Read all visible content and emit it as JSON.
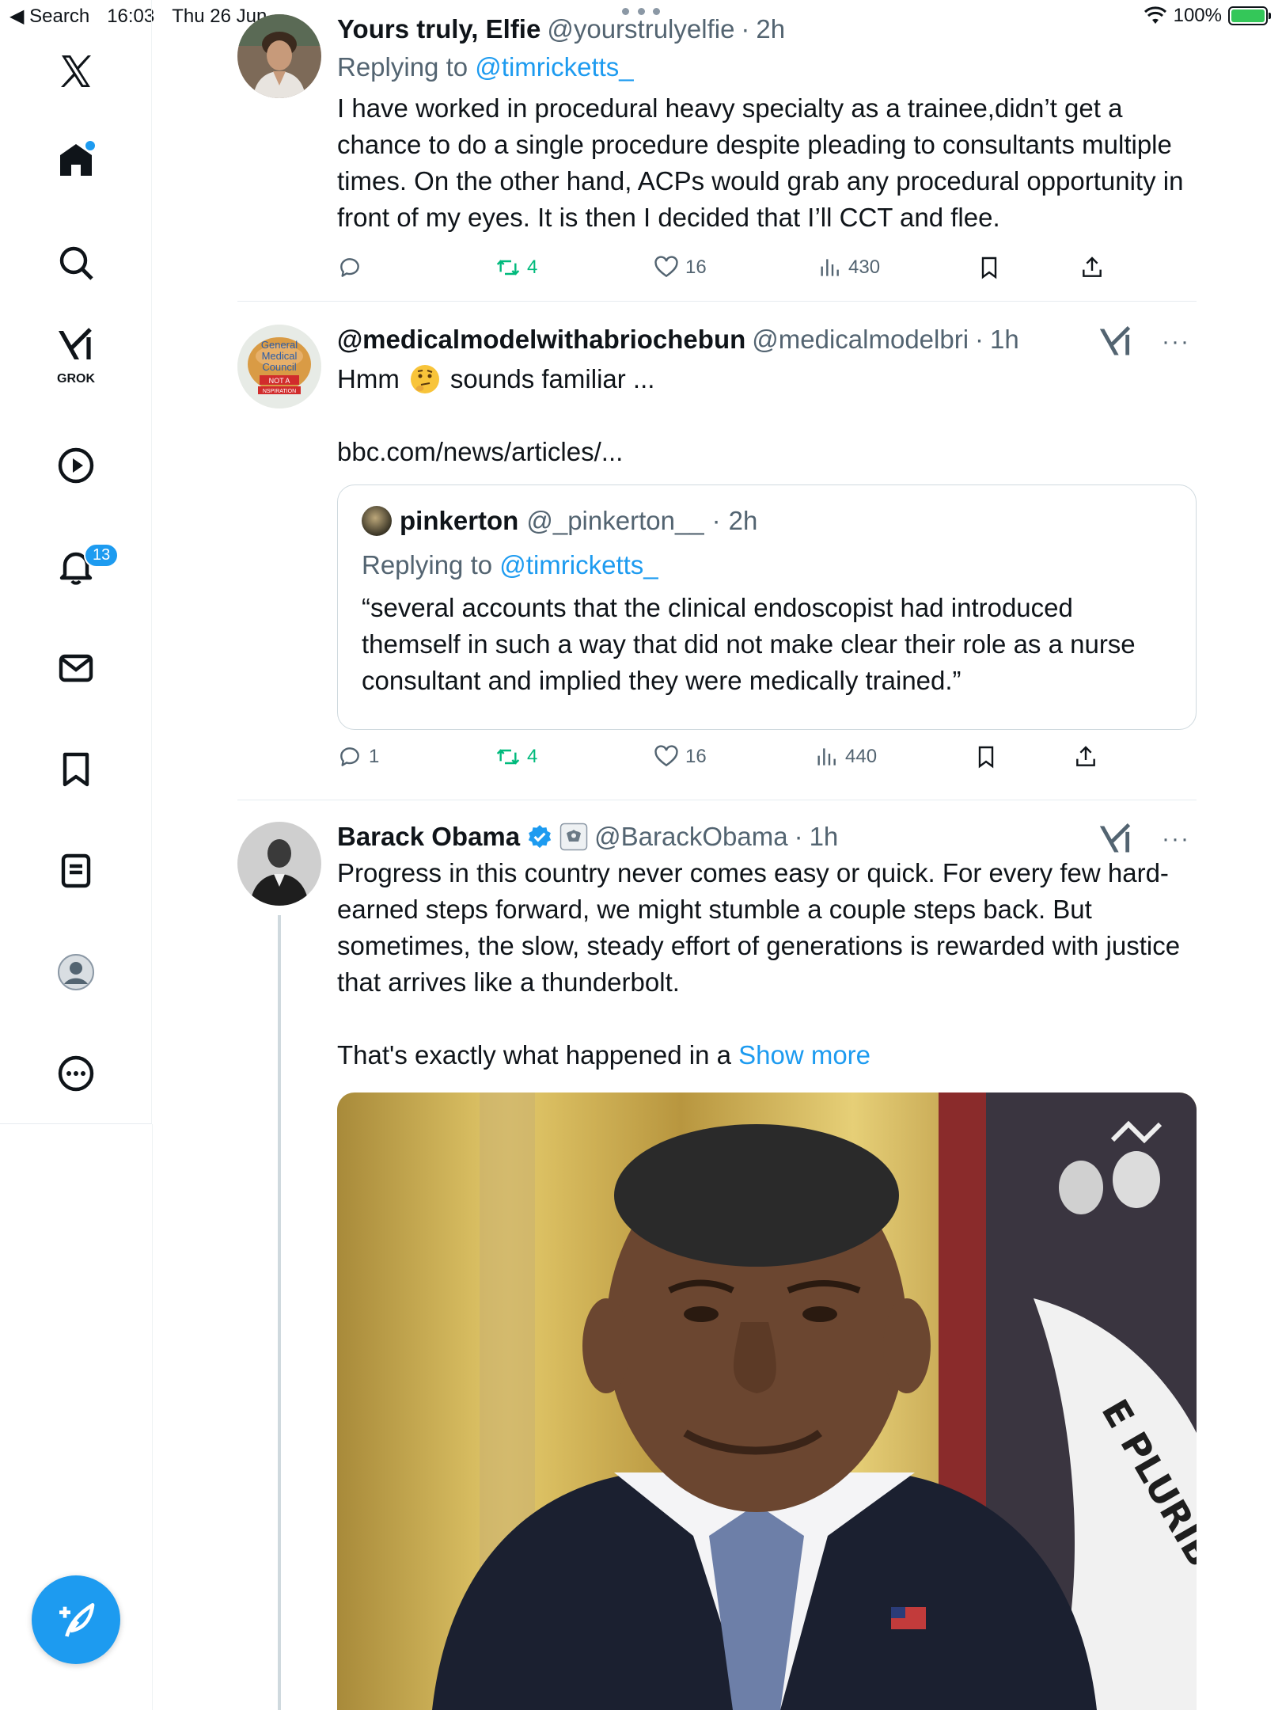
{
  "statusbar": {
    "back_label": "Search",
    "time": "16:03",
    "date": "Thu 26 Jun",
    "battery": "100%"
  },
  "sidebar": {
    "grok_label": "GROK",
    "notifications_badge": "13"
  },
  "tweets": [
    {
      "name": "Yours truly, Elfie",
      "handle": "@yourstrulyelfie",
      "time": "2h",
      "replying_prefix": "Replying to",
      "replying_to": "@timricketts_",
      "text": "I have worked in procedural heavy specialty as a trainee,didn’t get a chance to do a single procedure despite pleading to consultants multiple times. On the other hand, ACPs would grab any procedural opportunity in front of my eyes. It is then I decided that I’ll CCT and flee.",
      "reply_count": "",
      "retweet_count": "4",
      "like_count": "16",
      "view_count": "430"
    },
    {
      "name": "@medicalmodelwithabriochebun",
      "handle": "@medicalmodelbri",
      "time": "1h",
      "text_before": "Hmm",
      "text_after": "sounds familiar ...",
      "link": "bbc.com/news/articles/...",
      "avatar_text": [
        "General",
        "Medical",
        "Council",
        "NOT A",
        "NSPIRATION"
      ],
      "quote": {
        "name": "pinkerton",
        "handle": "@_pinkerton__",
        "time": "2h",
        "replying_prefix": "Replying to",
        "replying_to": "@timricketts_",
        "text": "“several accounts that the clinical endoscopist had introduced themself in such a way that did not make clear their role as a nurse consultant and implied they were medically trained.”"
      },
      "reply_count": "1",
      "retweet_count": "4",
      "like_count": "16",
      "view_count": "440"
    },
    {
      "name": "Barack Obama",
      "handle": "@BarackObama",
      "time": "1h",
      "text": "Progress in this country never comes easy or quick. For every few hard-earned steps forward, we might stumble a couple steps back. But sometimes, the slow, steady effort of generations is rewarded with justice that arrives like a thunderbolt.",
      "text2": "That's exactly what happened in a",
      "show_more": "Show more",
      "media_text": "E PLURIBUS UNU"
    }
  ],
  "colors": {
    "accent": "#1d9bf0",
    "retweet_green": "#00ba7c",
    "secondary_text": "#536471"
  }
}
